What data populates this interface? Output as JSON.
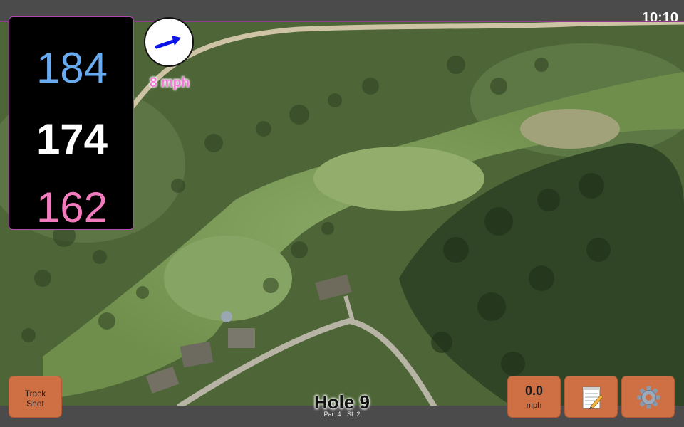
{
  "status": {
    "clock": "10:10"
  },
  "distances": {
    "back": "184",
    "center": "174",
    "front": "162"
  },
  "wind": {
    "speed": "8 mph",
    "icon": "wind-arrow-icon",
    "arrow_color": "#0a14e6"
  },
  "hole": {
    "title": "Hole 9",
    "par": "Par: 4",
    "si": "SI: 2"
  },
  "buttons": {
    "track_shot_line1": "Track",
    "track_shot_line2": "Shot",
    "speed_value": "0.0",
    "speed_unit": "mph",
    "notes_icon": "notepad-icon",
    "settings_icon": "gear-icon"
  },
  "colors": {
    "button_bg": "#cf6f44",
    "back_distance": "#6aabf0",
    "center_distance": "#ffffff",
    "front_distance": "#f27bbd",
    "panel_border": "#b04ab0"
  }
}
